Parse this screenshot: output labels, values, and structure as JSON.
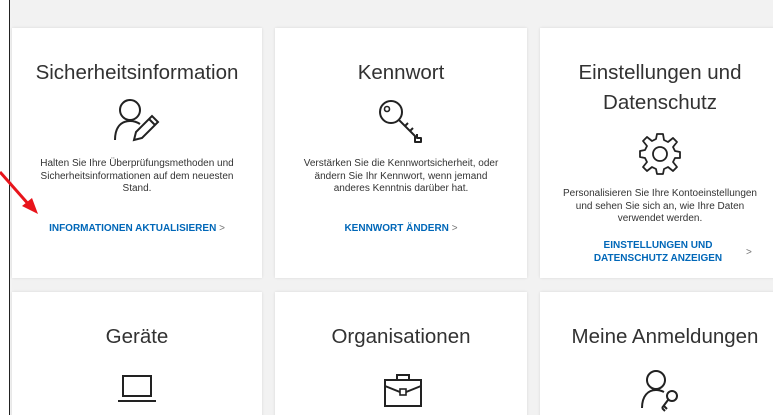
{
  "cards": [
    {
      "title": "Sicherheitsinformation",
      "icon": "user-edit-icon",
      "description_lines": [
        "Halten Sie Ihre Überprüfungsmethoden und",
        "Sicherheitsinformationen auf dem neuesten",
        "Stand."
      ],
      "link": "INFORMATIONEN AKTUALISIEREN",
      "chevron": ">"
    },
    {
      "title": "Kennwort",
      "icon": "key-icon",
      "description_lines": [
        "Verstärken Sie die Kennwortsicherheit, oder",
        "ändern Sie Ihr Kennwort, wenn jemand",
        "anderes Kenntnis darüber hat."
      ],
      "link": "KENNWORT ÄNDERN",
      "chevron": ">"
    },
    {
      "title_lines": [
        "Einstellungen und",
        "Datenschutz"
      ],
      "icon": "gear-icon",
      "description_lines": [
        "Personalisieren Sie Ihre Kontoeinstellungen",
        "und sehen Sie sich an, wie Ihre Daten",
        "verwendet werden."
      ],
      "link_lines": [
        "EINSTELLUNGEN UND",
        "DATENSCHUTZ ANZEIGEN"
      ],
      "chevron": ">"
    },
    {
      "title": "Geräte",
      "icon": "laptop-icon"
    },
    {
      "title": "Organisationen",
      "icon": "briefcase-icon"
    },
    {
      "title": "Meine Anmeldungen",
      "icon": "user-key-icon"
    }
  ],
  "annotation": {
    "icon": "red-arrow-icon",
    "color": "#e8141b"
  },
  "colors": {
    "link": "#0067b8",
    "background": "#f2f2f2",
    "card": "#ffffff"
  }
}
